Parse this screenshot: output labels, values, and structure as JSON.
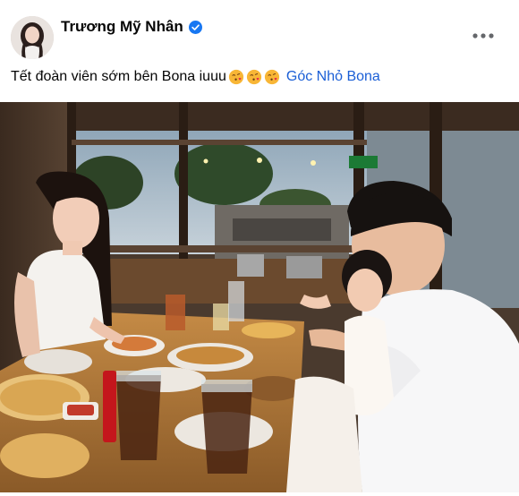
{
  "post": {
    "author": {
      "name": "Trương Mỹ Nhân",
      "verified": true
    },
    "caption_text": "Tết đoàn viên sớm bên Bona iuuu",
    "caption_emojis": [
      "face-blowing-kiss",
      "face-blowing-kiss",
      "face-blowing-kiss"
    ],
    "location_tag": "Góc Nhỏ Bona",
    "more_icon": "more-horizontal-icon"
  },
  "colors": {
    "link": "#1b5fd6",
    "verified": "#1877f2",
    "text": "#050505"
  }
}
